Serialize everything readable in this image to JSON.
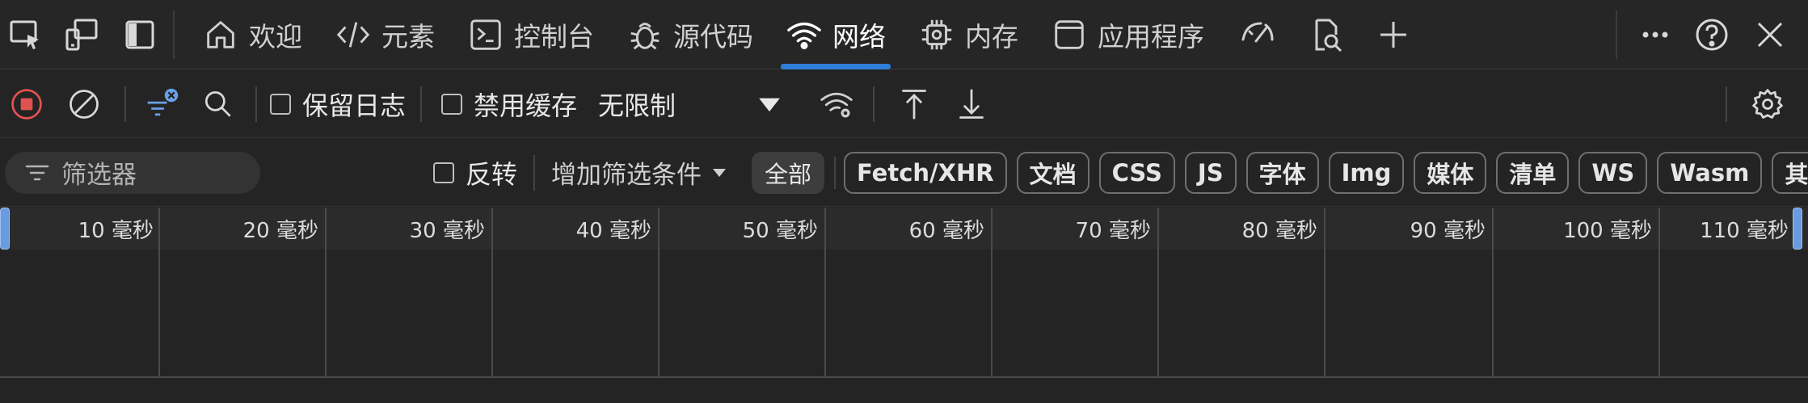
{
  "tabs": [
    {
      "label": "欢迎",
      "icon": "home-icon"
    },
    {
      "label": "元素",
      "icon": "code-icon"
    },
    {
      "label": "控制台",
      "icon": "console-icon"
    },
    {
      "label": "源代码",
      "icon": "bug-icon"
    },
    {
      "label": "网络",
      "icon": "wifi-icon",
      "active": true
    },
    {
      "label": "内存",
      "icon": "chip-icon"
    },
    {
      "label": "应用程序",
      "icon": "app-window-icon"
    }
  ],
  "toolbar": {
    "preserve_log": "保留日志",
    "disable_cache": "禁用缓存",
    "throttle": "无限制"
  },
  "filter": {
    "placeholder": "筛选器",
    "invert": "反转",
    "more_filters": "增加筛选条件",
    "chips": [
      "全部",
      "Fetch/XHR",
      "文档",
      "CSS",
      "JS",
      "字体",
      "Img",
      "媒体",
      "清单",
      "WS",
      "Wasm",
      "其他"
    ]
  },
  "timeline": {
    "labels": [
      "10 毫秒",
      "20 毫秒",
      "30 毫秒",
      "40 毫秒",
      "50 毫秒",
      "60 毫秒",
      "70 毫秒",
      "80 毫秒",
      "90 毫秒",
      "100 毫秒",
      "110 毫秒"
    ]
  },
  "colors": {
    "accent": "#2f7ed8",
    "record": "#e0524f",
    "background": "#242424"
  }
}
